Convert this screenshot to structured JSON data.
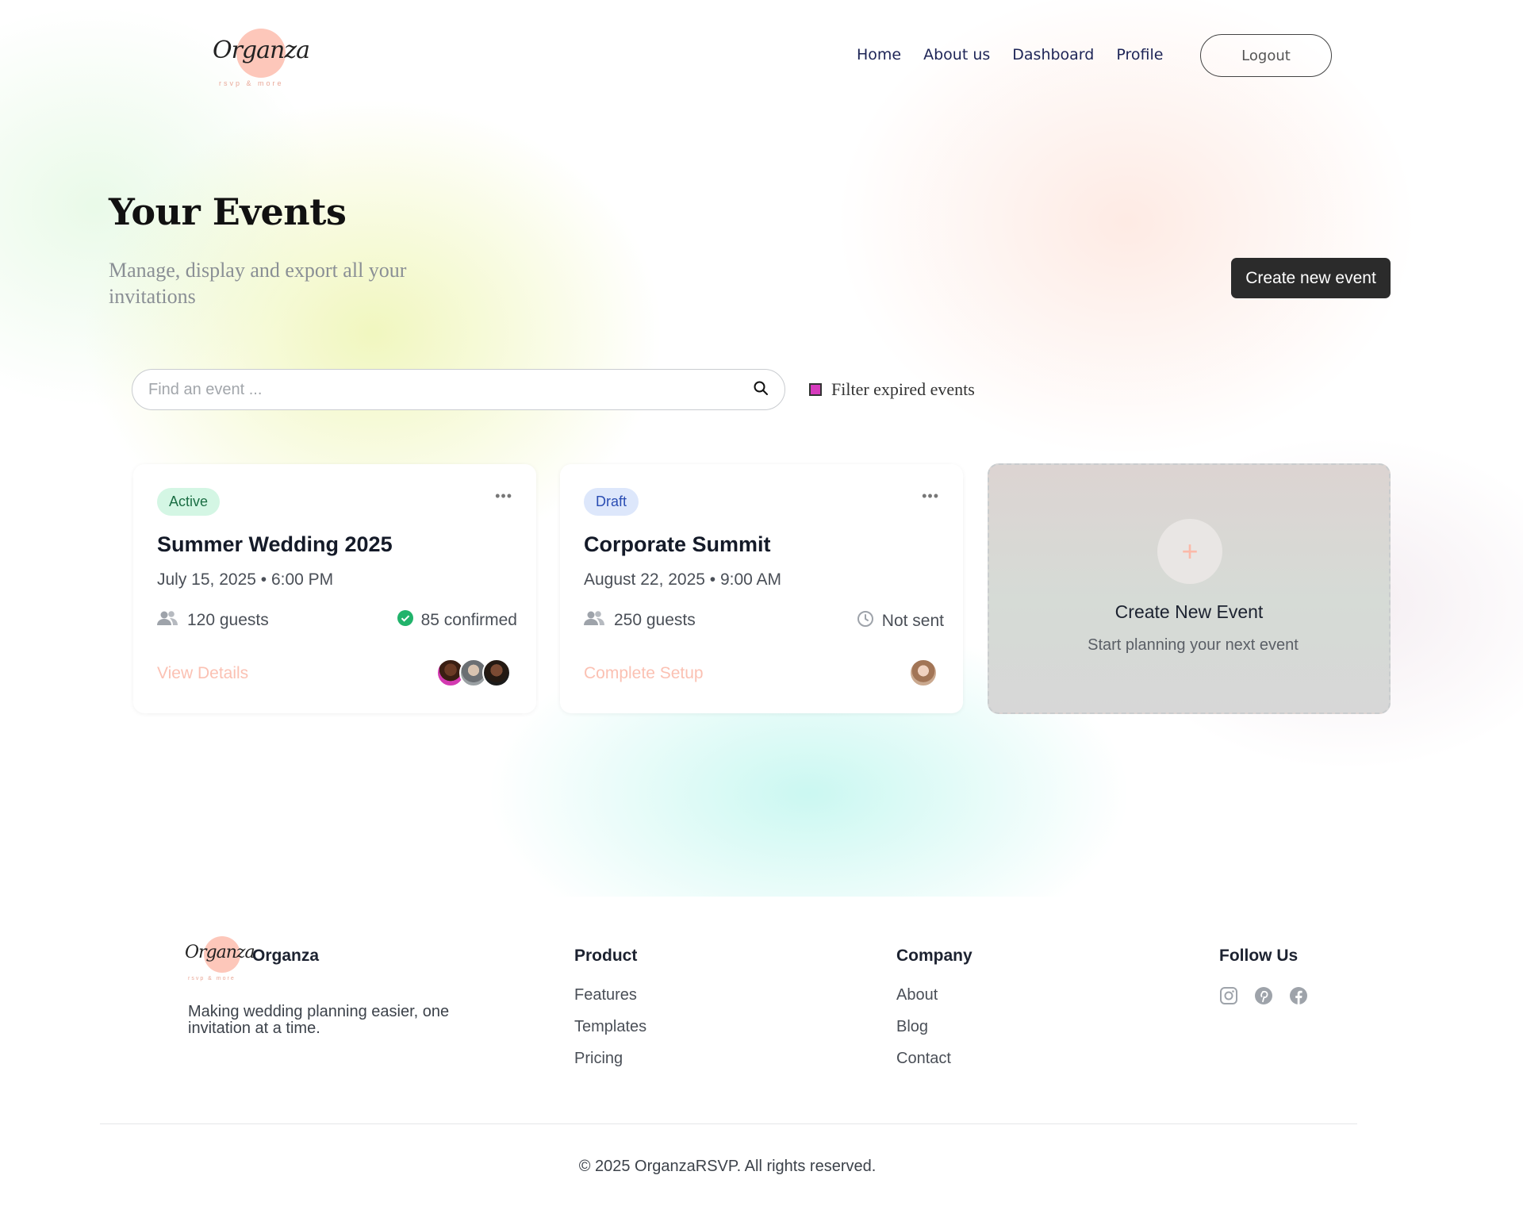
{
  "header": {
    "logo_text": "Organza",
    "logo_sub": "rsvp & more",
    "nav": [
      "Home",
      "About us",
      "Dashboard",
      "Profile"
    ],
    "logout_label": "Logout"
  },
  "hero": {
    "title": "Your Events",
    "subtitle": "Manage, display and export all your invitations",
    "create_button": "Create new event"
  },
  "search": {
    "placeholder": "Find an event ...",
    "filter_label": "Filter expired events",
    "filter_checked": true
  },
  "events": [
    {
      "status": "Active",
      "title": "Summer Wedding 2025",
      "datetime": "July 15, 2025 • 6:00 PM",
      "guests": "120 guests",
      "rsvp": "85 confirmed",
      "action": "View Details"
    },
    {
      "status": "Draft",
      "title": "Corporate Summit",
      "datetime": "August 22, 2025 • 9:00 AM",
      "guests": "250 guests",
      "rsvp": "Not sent",
      "action": "Complete Setup"
    }
  ],
  "new_event_card": {
    "title": "Create New Event",
    "subtitle": "Start planning your next event"
  },
  "footer": {
    "brand": "Organza",
    "tagline": "Making wedding planning easier, one invitation at a time.",
    "product": {
      "heading": "Product",
      "links": [
        "Features",
        "Templates",
        "Pricing"
      ]
    },
    "company": {
      "heading": "Company",
      "links": [
        "About",
        "Blog",
        "Contact"
      ]
    },
    "follow": {
      "heading": "Follow Us",
      "icons": [
        "instagram-icon",
        "pinterest-icon",
        "facebook-icon"
      ]
    },
    "copyright": "© 2025 OrganzaRSVP. All rights reserved."
  },
  "colors": {
    "accent_peach": "#fdc7ba",
    "button_dark": "#2b2b2b",
    "active_badge": "#d4f6e4",
    "draft_badge": "#dde7fb",
    "confirmed_green": "#21b36b"
  }
}
